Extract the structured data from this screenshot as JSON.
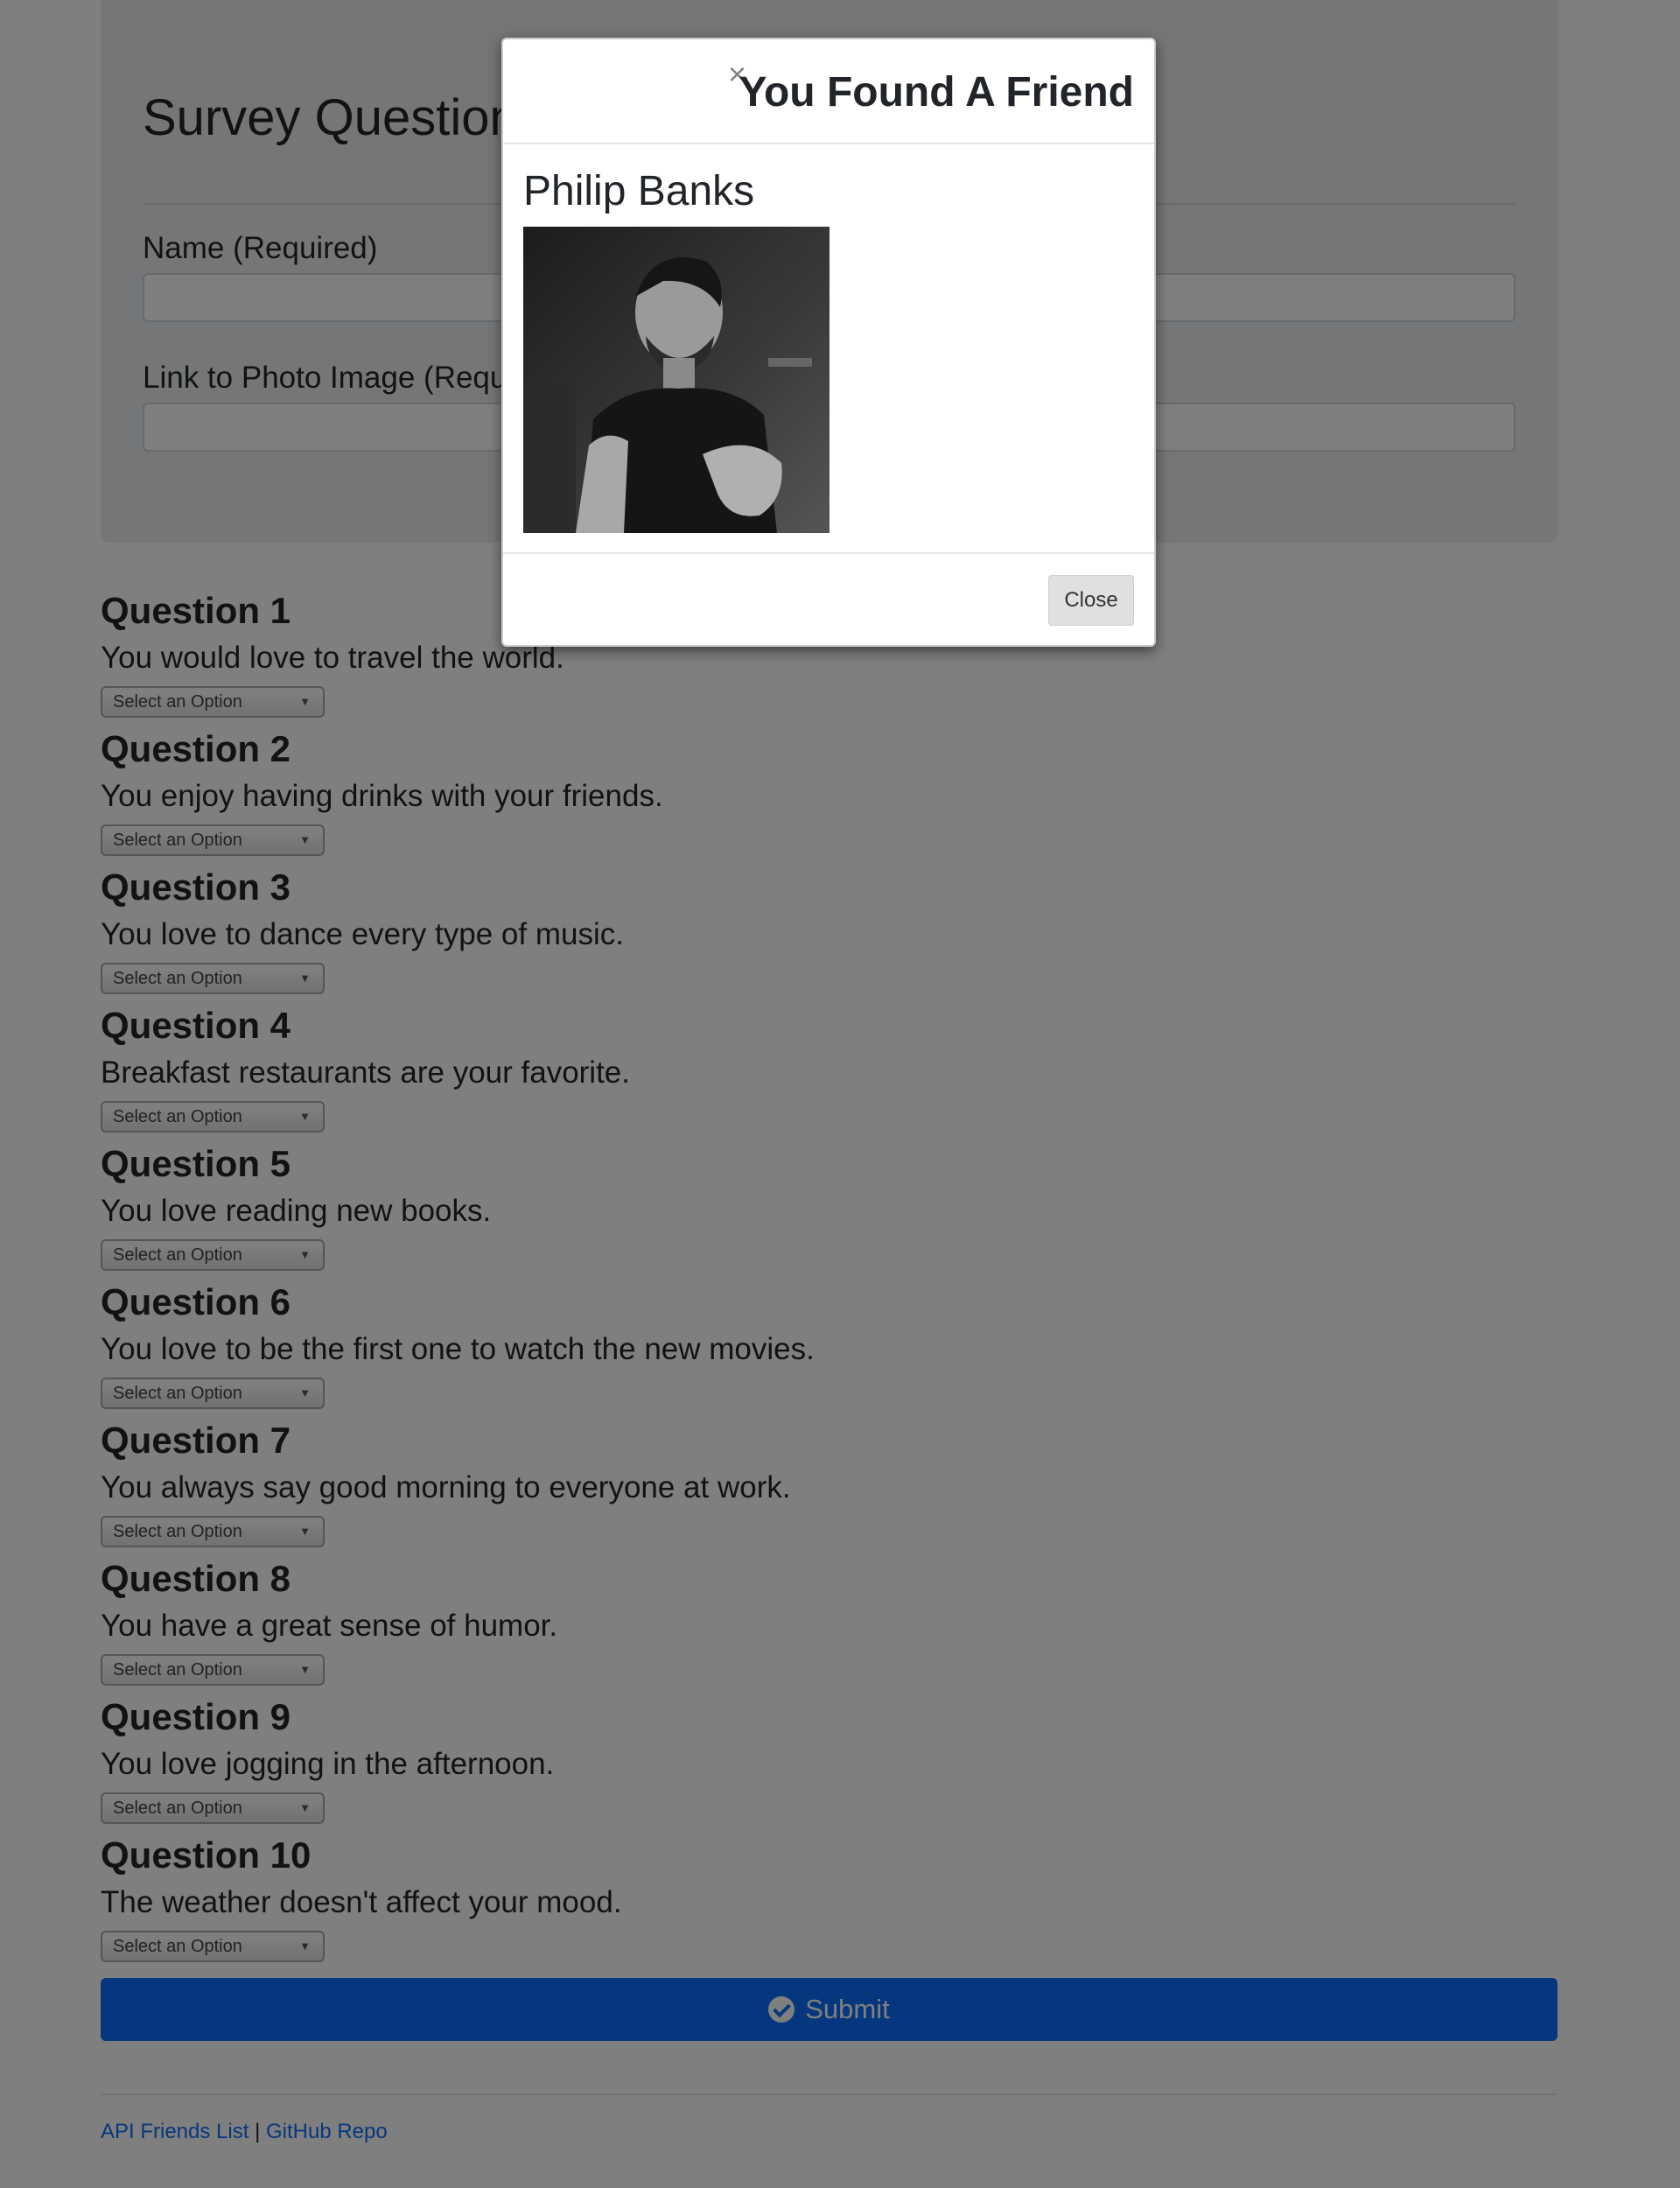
{
  "survey": {
    "title": "Survey Questions",
    "name_label": "Name (Required)",
    "photo_label": "Link to Photo Image (Required)",
    "name_value": "",
    "photo_value": ""
  },
  "questions": [
    {
      "heading": "Question 1",
      "text": "You would love to travel the world.",
      "selected": "Select an Option"
    },
    {
      "heading": "Question 2",
      "text": "You enjoy having drinks with your friends.",
      "selected": "Select an Option"
    },
    {
      "heading": "Question 3",
      "text": "You love to dance every type of music.",
      "selected": "Select an Option"
    },
    {
      "heading": "Question 4",
      "text": "Breakfast restaurants are your favorite.",
      "selected": "Select an Option"
    },
    {
      "heading": "Question 5",
      "text": "You love reading new books.",
      "selected": "Select an Option"
    },
    {
      "heading": "Question 6",
      "text": "You love to be the first one to watch the new movies.",
      "selected": "Select an Option"
    },
    {
      "heading": "Question 7",
      "text": "You always say good morning to everyone at work.",
      "selected": "Select an Option"
    },
    {
      "heading": "Question 8",
      "text": "You have a great sense of humor.",
      "selected": "Select an Option"
    },
    {
      "heading": "Question 9",
      "text": "You love jogging in the afternoon.",
      "selected": "Select an Option"
    },
    {
      "heading": "Question 10",
      "text": "The weather doesn't affect your mood.",
      "selected": "Select an Option"
    }
  ],
  "submit_label": "Submit",
  "footer": {
    "link1": "API Friends List",
    "separator": "|",
    "link2": "GitHub Repo"
  },
  "modal": {
    "title": "You Found A Friend",
    "close_symbol": "×",
    "friend_name": "Philip Banks",
    "close_label": "Close"
  },
  "colors": {
    "primary": "#0d6efd",
    "backdrop": "rgba(0,0,0,0.5)"
  },
  "icons": {
    "submit": "check-circle-icon",
    "dropdown": "caret-down-icon",
    "modal_close": "close-icon"
  }
}
